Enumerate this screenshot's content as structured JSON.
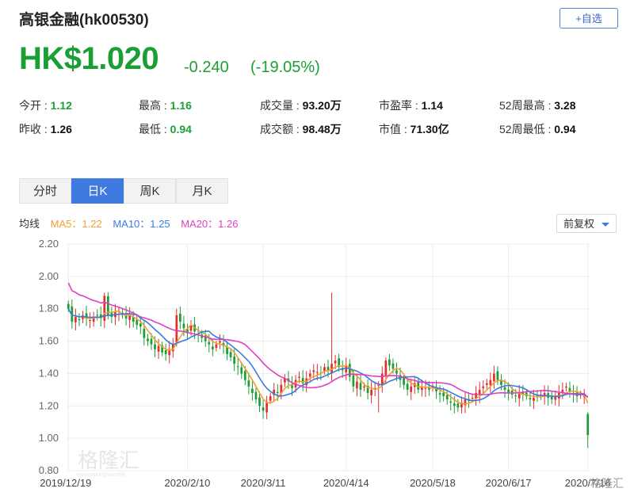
{
  "header": {
    "title": "高银金融(hk00530)",
    "add_button": "+自选",
    "price": "HK$1.020",
    "change": "-0.240",
    "change_pct": "(-19.05%)",
    "down_color": "#1a9f35"
  },
  "stats": {
    "open_label": "今开 :",
    "open_value": "1.12",
    "prev_close_label": "昨收 :",
    "prev_close_value": "1.26",
    "high_label": "最高 :",
    "high_value": "1.16",
    "low_label": "最低 :",
    "low_value": "0.94",
    "volume_label": "成交量 :",
    "volume_value": "93.20万",
    "turnover_label": "成交额 :",
    "turnover_value": "98.48万",
    "pe_label": "市盈率 :",
    "pe_value": "1.14",
    "mcap_label": "市值 :",
    "mcap_value": "71.30亿",
    "w52_high_label": "52周最高 :",
    "w52_high_value": "3.28",
    "w52_low_label": "52周最低 :",
    "w52_low_value": "0.94"
  },
  "tabs": [
    {
      "label": "分时",
      "active": false
    },
    {
      "label": "日K",
      "active": true
    },
    {
      "label": "周K",
      "active": false
    },
    {
      "label": "月K",
      "active": false
    }
  ],
  "ma_legend": {
    "prefix": "均线",
    "ma5": "MA5：1.22",
    "ma10": "MA10：1.25",
    "ma20": "MA20：1.26",
    "ma5_color": "#f0a030",
    "ma10_color": "#3a7ae0",
    "ma20_color": "#e040c0"
  },
  "adjust_dropdown": "前复权",
  "watermarks": {
    "left_brand": "格隆汇",
    "left_url": "www.gelonghui.com",
    "right_brand": "格隆汇"
  },
  "chart_data": {
    "type": "candlestick",
    "up_color": "#e03030",
    "down_color": "#1a9f35",
    "ylim": [
      0.8,
      2.2
    ],
    "yticks": [
      "2.20",
      "2.00",
      "1.80",
      "1.60",
      "1.40",
      "1.20",
      "1.00",
      "0.80"
    ],
    "xticks": [
      {
        "label": "2019/12/19",
        "index": 0
      },
      {
        "label": "2020/2/10",
        "index": 33
      },
      {
        "label": "2020/3/11",
        "index": 54
      },
      {
        "label": "2020/4/14",
        "index": 77
      },
      {
        "label": "2020/5/18",
        "index": 101
      },
      {
        "label": "2020/6/17",
        "index": 122
      },
      {
        "label": "2020/7/16",
        "index": 144
      }
    ],
    "grid": true,
    "series_keys": [
      "ma5",
      "ma10",
      "ma20"
    ],
    "close": [
      1.8,
      1.72,
      1.75,
      1.73,
      1.76,
      1.74,
      1.73,
      1.75,
      1.76,
      1.74,
      1.88,
      1.76,
      1.75,
      1.78,
      1.77,
      1.76,
      1.74,
      1.76,
      1.72,
      1.7,
      1.69,
      1.62,
      1.6,
      1.58,
      1.55,
      1.57,
      1.53,
      1.52,
      1.55,
      1.58,
      1.76,
      1.72,
      1.68,
      1.65,
      1.7,
      1.66,
      1.64,
      1.62,
      1.6,
      1.58,
      1.55,
      1.58,
      1.6,
      1.57,
      1.52,
      1.5,
      1.46,
      1.44,
      1.4,
      1.36,
      1.32,
      1.28,
      1.24,
      1.2,
      1.17,
      1.22,
      1.26,
      1.3,
      1.28,
      1.33,
      1.37,
      1.35,
      1.31,
      1.36,
      1.38,
      1.34,
      1.37,
      1.4,
      1.42,
      1.41,
      1.4,
      1.44,
      1.42,
      1.46,
      1.48,
      1.44,
      1.42,
      1.45,
      1.38,
      1.32,
      1.35,
      1.3,
      1.32,
      1.28,
      1.3,
      1.31,
      1.33,
      1.4,
      1.48,
      1.45,
      1.43,
      1.4,
      1.36,
      1.33,
      1.3,
      1.32,
      1.34,
      1.3,
      1.32,
      1.31,
      1.3,
      1.32,
      1.29,
      1.27,
      1.26,
      1.24,
      1.22,
      1.2,
      1.19,
      1.22,
      1.24,
      1.23,
      1.25,
      1.28,
      1.3,
      1.32,
      1.34,
      1.36,
      1.4,
      1.36,
      1.33,
      1.3,
      1.28,
      1.27,
      1.26,
      1.28,
      1.27,
      1.26,
      1.24,
      1.25,
      1.26,
      1.27,
      1.28,
      1.25,
      1.24,
      1.26,
      1.28,
      1.3,
      1.32,
      1.29,
      1.27,
      1.26,
      1.27,
      1.26,
      1.02
    ]
  }
}
